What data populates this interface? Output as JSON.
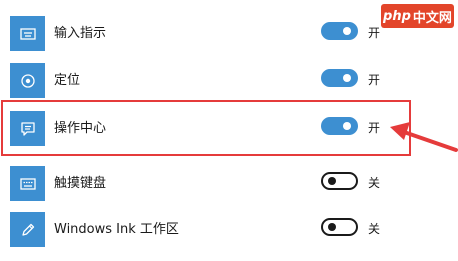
{
  "settings": [
    {
      "label": "输入指示",
      "icon": "keyboard-icon",
      "enabled": true,
      "state_label": "开"
    },
    {
      "label": "定位",
      "icon": "location-icon",
      "enabled": true,
      "state_label": "开"
    },
    {
      "label": "操作中心",
      "icon": "action-center-icon",
      "enabled": true,
      "state_label": "开"
    },
    {
      "label": "触摸键盘",
      "icon": "touch-keyboard-icon",
      "enabled": false,
      "state_label": "关"
    },
    {
      "label": "Windows Ink 工作区",
      "icon": "pen-icon",
      "enabled": false,
      "state_label": "关"
    }
  ],
  "watermark": {
    "brand": "php",
    "site": "中文网"
  },
  "colors": {
    "accent": "#3d8fd1",
    "highlight": "#e53b3b",
    "watermark_bg": "#e3452a"
  }
}
